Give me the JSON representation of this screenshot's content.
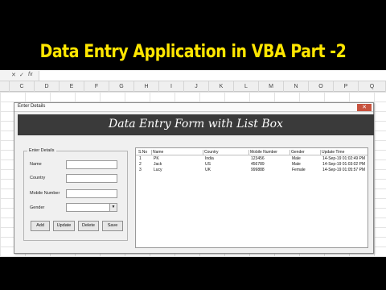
{
  "banner": {
    "title": "Data Entry Application in VBA Part -2"
  },
  "excel": {
    "formula_bar": {
      "cancel": "✕",
      "enter": "✓",
      "fx": "fx"
    },
    "columns": [
      "C",
      "D",
      "E",
      "F",
      "G",
      "H",
      "I",
      "J",
      "K",
      "L",
      "M",
      "N",
      "O",
      "P",
      "Q"
    ]
  },
  "form": {
    "title": "Enter Details",
    "close_icon": "✕",
    "header": "Data Entry Form with List Box",
    "frame_legend": "Enter Details",
    "fields": {
      "name_label": "Name",
      "name_value": "",
      "country_label": "Country",
      "country_value": "",
      "mobile_label": "Mobile Number",
      "mobile_value": "",
      "gender_label": "Gender",
      "gender_value": ""
    },
    "buttons": {
      "add": "Add",
      "update": "Update",
      "delete": "Delete",
      "save": "Save"
    },
    "listbox": {
      "headers": [
        "S.No",
        "Name",
        "Country",
        "Mobile Number",
        "Gender",
        "Update Time"
      ],
      "rows": [
        [
          "1",
          "PK",
          "India",
          "123456",
          "Male",
          "14-Sep-19 01:02:49 PM"
        ],
        [
          "2",
          "Jack",
          "US",
          "456789",
          "Male",
          "14-Sep-19 01:03:02 PM"
        ],
        [
          "3",
          "Lucy",
          "UK",
          "999888",
          "Female",
          "14-Sep-19 01:05:57 PM"
        ]
      ]
    }
  },
  "colors": {
    "banner_text": "#ffe600",
    "header_band": "#3a3a3a",
    "close_button": "#c7533f"
  }
}
